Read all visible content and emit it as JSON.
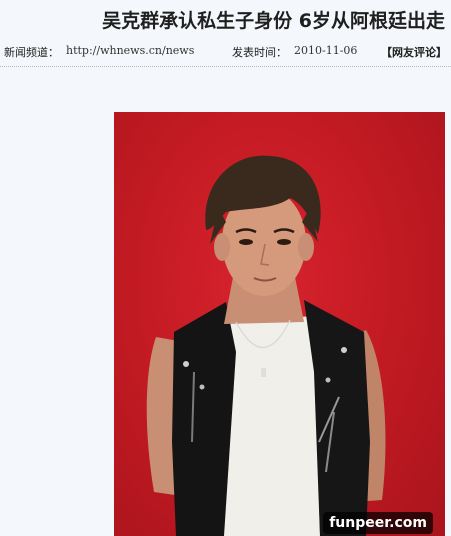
{
  "article": {
    "headline": "吴克群承认私生子身份 6岁从阿根廷出走",
    "channel_label": "新闻频道：",
    "channel_url": "http://whnews.cn/news",
    "publish_label": "发表时间：",
    "publish_date": "2010-11-06",
    "comment_link": "【网友评论】"
  },
  "photo": {
    "watermark_text": "funpeer.com",
    "background_color": "#c51b24"
  }
}
